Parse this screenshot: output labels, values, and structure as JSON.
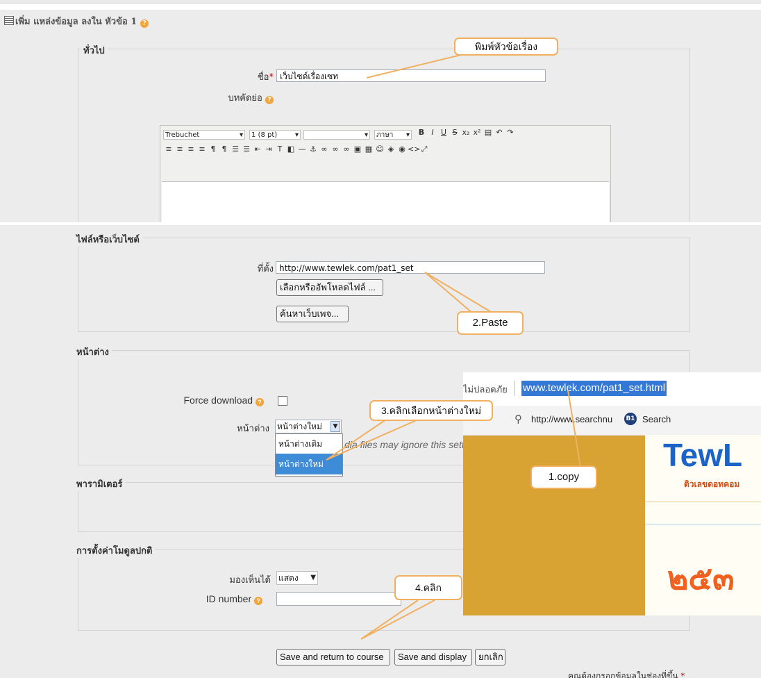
{
  "heading": {
    "text": "เพิ่ม แหล่งข้อมูล ลงใน หัวข้อ 1"
  },
  "general": {
    "legend": "ทั่วไป",
    "name_label": "ชื่อ",
    "name_value": "เว็บไซด์เรื่องเซท",
    "summary_label": "บทคัดย่อ",
    "editor": {
      "font": "Trebuchet",
      "size": "1 (8 pt)",
      "lang": "ภาษา"
    }
  },
  "file_site": {
    "legend": "ไฟล์หรือเว็บไซต์",
    "location_label": "ที่ตั้ง",
    "location_value": "http://www.tewlek.com/pat1_set",
    "choose_button": "เลือกหรืออัพโหลดไฟล์ ...",
    "search_button": "ค้นหาเว็บเพจ..."
  },
  "window": {
    "legend": "หน้าต่าง",
    "force_label": "Force download",
    "window_label": "หน้าต่าง",
    "window_value": "หน้าต่างใหม่",
    "options": [
      "หน้าต่างเดิม",
      "หน้าต่างใหม่"
    ],
    "hint": "dia files may ignore this setti"
  },
  "params": {
    "legend": "พารามิเตอร์"
  },
  "module": {
    "legend": "การตั้งค่าโมดูลปกติ",
    "visible_label": "มองเห็นได้",
    "visible_value": "แสดง",
    "id_label": "ID number"
  },
  "buttons": {
    "save_return": "Save and return to course",
    "save_display": "Save and display",
    "cancel": "ยกเลิก"
  },
  "required_note": "คุณต้องกรอกข้อมูลในช่องที่ขึ้น",
  "callouts": {
    "type_title": "พิมพ์หัวข้อเรื่อง",
    "paste": "2.Paste",
    "pick_window": "3.คลิกเลือกหน้าต่างใหม่",
    "copy": "1.copy",
    "click": "4.คลิก"
  },
  "browser": {
    "insecure": "ไม่ปลอดภัย",
    "url": "www.tewlek.com/pat1_set.html",
    "bookmark1": "http://www.searchnu",
    "bookmark2": "Search",
    "logo": "TewL",
    "tagline": "ติวเลขดอทคอม",
    "big_text": "๒๕๓"
  },
  "colors": {
    "callout_border": "#f0b060",
    "accent_help": "#f1a53a",
    "inset_bg": "#d9a333"
  }
}
